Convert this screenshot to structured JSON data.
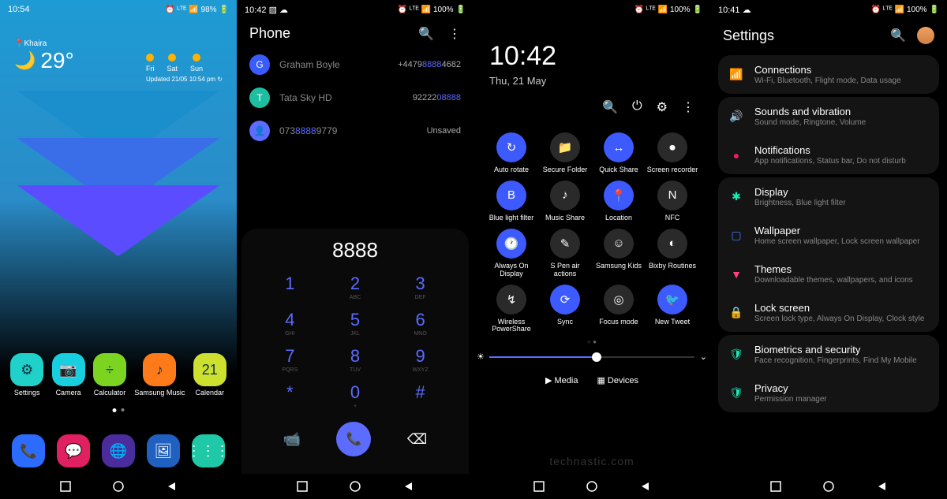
{
  "s1": {
    "time": "10:54",
    "battery": "98%",
    "location": "Khaira",
    "temp": "29°",
    "forecast": [
      {
        "day": "Fri"
      },
      {
        "day": "Sat"
      },
      {
        "day": "Sun"
      }
    ],
    "updated": "Updated 21/05 10:54 pm ↻",
    "row1": [
      {
        "label": "Settings",
        "bg": "#1fd1c9",
        "glyph": "⚙"
      },
      {
        "label": "Camera",
        "bg": "#18cfe0",
        "glyph": "📷"
      },
      {
        "label": "Calculator",
        "bg": "#7cd420",
        "glyph": "÷"
      },
      {
        "label": "Samsung Music",
        "bg": "#ff7a18",
        "glyph": "♪"
      },
      {
        "label": "Calendar",
        "bg": "#cde030",
        "glyph": "21"
      }
    ],
    "row2": [
      {
        "label": "",
        "bg": "#2b6cff",
        "glyph": "📞"
      },
      {
        "label": "",
        "bg": "#e02060",
        "glyph": "💬"
      },
      {
        "label": "",
        "bg": "#4a2c9c",
        "glyph": "🌐"
      },
      {
        "label": "",
        "bg": "#2060c0",
        "glyph": "🖼"
      },
      {
        "label": "",
        "bg": "#1fc9a8",
        "glyph": "⋮⋮⋮"
      }
    ]
  },
  "s2": {
    "time": "10:42",
    "battery": "100%",
    "title": "Phone",
    "contacts": [
      {
        "initial": "G",
        "color": "#3a5cff",
        "name": "Graham Boyle",
        "num_pre": "+4479",
        "num_hl": "8888",
        "num_post": "4682"
      },
      {
        "initial": "T",
        "color": "#1dbfa0",
        "name": "Tata Sky HD",
        "num_pre": "92222",
        "num_hl": "08888",
        "num_post": ""
      },
      {
        "initial": "👤",
        "color": "#5b6cff",
        "name_pre": "073",
        "name_hl": "8888",
        "name_post": "9779",
        "status": "Unsaved"
      }
    ],
    "dialed": "8888",
    "keys": [
      [
        [
          "1",
          ""
        ],
        [
          "2",
          "ABC"
        ],
        [
          "3",
          "DEF"
        ]
      ],
      [
        [
          "4",
          "GHI"
        ],
        [
          "5",
          "JKL"
        ],
        [
          "6",
          "MNO"
        ]
      ],
      [
        [
          "7",
          "PQRS"
        ],
        [
          "8",
          "TUV"
        ],
        [
          "9",
          "WXYZ"
        ]
      ],
      [
        [
          "*",
          ""
        ],
        [
          "0",
          "+"
        ],
        [
          "#",
          ""
        ]
      ]
    ]
  },
  "s3": {
    "battery": "100%",
    "clock": "10:42",
    "date": "Thu, 21 May",
    "tiles": [
      {
        "label": "Auto rotate",
        "on": true,
        "glyph": "↻"
      },
      {
        "label": "Secure Folder",
        "on": false,
        "glyph": "📁"
      },
      {
        "label": "Quick Share",
        "on": true,
        "glyph": "↔"
      },
      {
        "label": "Screen recorder",
        "on": false,
        "glyph": "⏺"
      },
      {
        "label": "Blue light filter",
        "on": true,
        "glyph": "B"
      },
      {
        "label": "Music Share",
        "on": false,
        "glyph": "♪"
      },
      {
        "label": "Location",
        "on": true,
        "glyph": "📍"
      },
      {
        "label": "NFC",
        "on": false,
        "glyph": "N"
      },
      {
        "label": "Always On Display",
        "on": true,
        "glyph": "🕐"
      },
      {
        "label": "S Pen air actions",
        "on": false,
        "glyph": "✎"
      },
      {
        "label": "Samsung Kids",
        "on": false,
        "glyph": "☺"
      },
      {
        "label": "Bixby Routines",
        "on": false,
        "glyph": "◐"
      },
      {
        "label": "Wireless PowerShare",
        "on": false,
        "glyph": "↯"
      },
      {
        "label": "Sync",
        "on": true,
        "glyph": "⟳"
      },
      {
        "label": "Focus mode",
        "on": false,
        "glyph": "◎"
      },
      {
        "label": "New Tweet",
        "on": true,
        "glyph": "🐦"
      }
    ],
    "media": "Media",
    "devices": "Devices",
    "watermark": "technastic.com"
  },
  "s4": {
    "time": "10:41",
    "battery": "100%",
    "title": "Settings",
    "groups": [
      [
        {
          "icon": "📶",
          "color": "#3d7bff",
          "title": "Connections",
          "sub": "Wi-Fi, Bluetooth, Flight mode, Data usage"
        }
      ],
      [
        {
          "icon": "🔊",
          "color": "#ffb300",
          "title": "Sounds and vibration",
          "sub": "Sound mode, Ringtone, Volume"
        },
        {
          "icon": "●",
          "color": "#e91e63",
          "title": "Notifications",
          "sub": "App notifications, Status bar, Do not disturb"
        }
      ],
      [
        {
          "icon": "✱",
          "color": "#1de9b6",
          "title": "Display",
          "sub": "Brightness, Blue light filter"
        },
        {
          "icon": "▢",
          "color": "#3d7bff",
          "title": "Wallpaper",
          "sub": "Home screen wallpaper, Lock screen wallpaper"
        },
        {
          "icon": "▼",
          "color": "#ff4081",
          "title": "Themes",
          "sub": "Downloadable themes, wallpapers, and icons"
        },
        {
          "icon": "🔒",
          "color": "#888",
          "title": "Lock screen",
          "sub": "Screen lock type, Always On Display, Clock style"
        }
      ],
      [
        {
          "icon": "🛡",
          "color": "#1de9b6",
          "title": "Biometrics and security",
          "sub": "Face recognition, Fingerprints, Find My Mobile"
        },
        {
          "icon": "🛡",
          "color": "#1de9b6",
          "title": "Privacy",
          "sub": "Permission manager"
        }
      ]
    ]
  }
}
